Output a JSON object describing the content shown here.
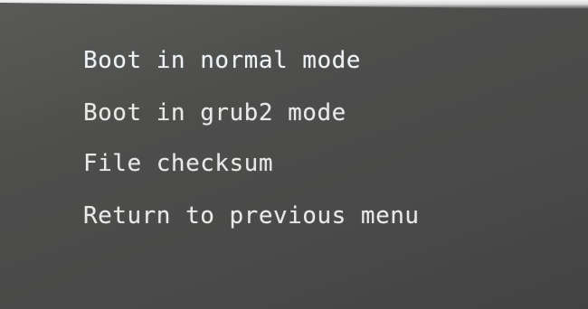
{
  "menu": {
    "items": [
      {
        "label": "Boot in normal mode",
        "selected": true
      },
      {
        "label": "Boot in grub2 mode",
        "selected": false
      },
      {
        "label": "File checksum",
        "selected": false
      },
      {
        "label": "Return to previous menu",
        "selected": false
      }
    ],
    "highlight_color": "#4a80b8",
    "text_color": "#e9e9e9",
    "background_color": "#4d4d4d"
  }
}
